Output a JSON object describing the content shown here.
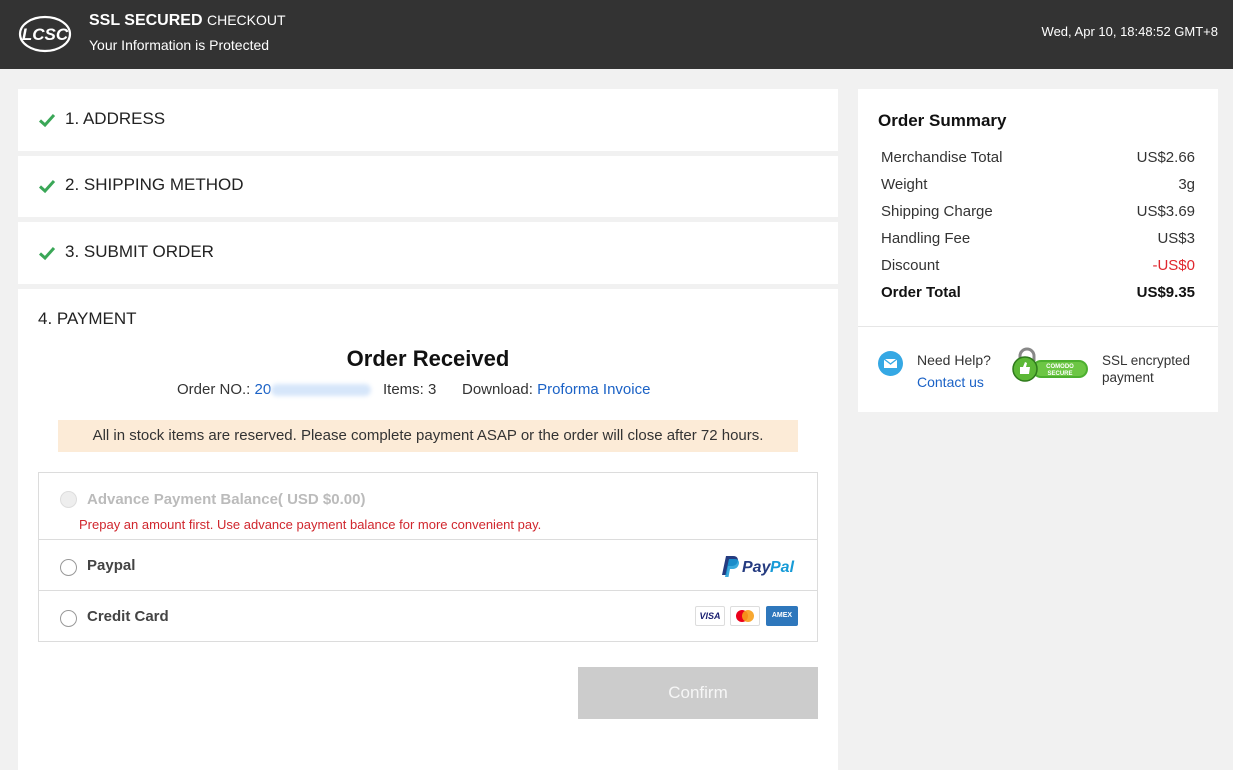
{
  "header": {
    "logo_text": "LCSC",
    "ssl_bold": "SSL SECURED",
    "ssl_light": "CHECKOUT",
    "subtitle": "Your Information is Protected",
    "datetime": "Wed, Apr 10, 18:48:52 GMT+8"
  },
  "steps": [
    {
      "label": "1. ADDRESS",
      "done": true
    },
    {
      "label": "2. SHIPPING METHOD",
      "done": true
    },
    {
      "label": "3. SUBMIT ORDER",
      "done": true
    },
    {
      "label": "4. PAYMENT",
      "done": false
    }
  ],
  "payment": {
    "heading": "Order Received",
    "order_no_label": "Order NO.:",
    "order_no_visible": "20",
    "items_label": "Items: 3",
    "download_label": "Download:",
    "download_link": "Proforma Invoice",
    "notice": "All in stock items are reserved. Please complete payment ASAP or the order will close after 72 hours.",
    "methods": [
      {
        "label": "Advance Payment Balance( USD $0.00)",
        "disabled": true,
        "warning": "Prepay an amount first. Use advance payment balance for more convenient pay."
      },
      {
        "label": "Paypal",
        "disabled": false,
        "brand": "PayPal"
      },
      {
        "label": "Credit Card",
        "disabled": false,
        "cards": [
          "VISA",
          "mastercard-icon",
          "AMEX"
        ]
      }
    ],
    "confirm_label": "Confirm"
  },
  "summary": {
    "title": "Order Summary",
    "rows": [
      {
        "label": "Merchandise Total",
        "value": "US$2.66"
      },
      {
        "label": "Weight",
        "value": "3g"
      },
      {
        "label": "Shipping Charge",
        "value": "US$3.69"
      },
      {
        "label": "Handling Fee",
        "value": "US$3"
      },
      {
        "label": "Discount",
        "value": "-US$0"
      },
      {
        "label": "Order Total",
        "value": "US$9.35"
      }
    ],
    "help_label": "Need Help?",
    "contact_label": "Contact us",
    "comodo_text": "COMODO SECURE",
    "ssl_text": "SSL encrypted payment"
  },
  "colors": {
    "topbar": "#333333",
    "check_green": "#3aa757",
    "link_blue": "#1b62c6",
    "discount_red": "#e0262d",
    "notice_bg": "#fcebd7"
  }
}
